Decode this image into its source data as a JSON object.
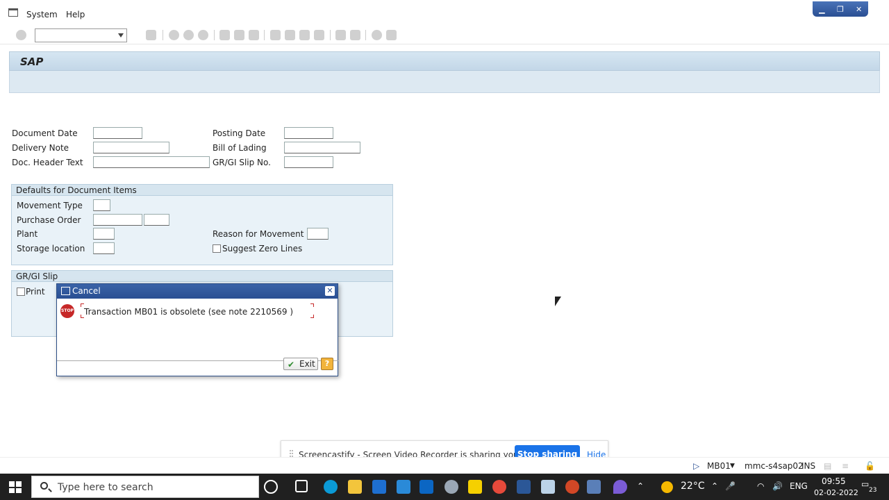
{
  "menu": {
    "items": [
      "System",
      "Help"
    ]
  },
  "screen": {
    "title": "SAP"
  },
  "header_fields": {
    "document_date": {
      "label": "Document Date",
      "value": ""
    },
    "posting_date": {
      "label": "Posting Date",
      "value": ""
    },
    "delivery_note": {
      "label": "Delivery Note",
      "value": ""
    },
    "bill_of_lading": {
      "label": "Bill of Lading",
      "value": ""
    },
    "doc_header_text": {
      "label": "Doc. Header Text",
      "value": ""
    },
    "gr_gi_slip_no": {
      "label": "GR/GI Slip No.",
      "value": ""
    }
  },
  "defaults_group": {
    "title": "Defaults for Document Items",
    "movement_type": "Movement Type",
    "purchase_order": "Purchase Order",
    "plant": "Plant",
    "storage_location": "Storage location",
    "reason_for_movement": "Reason for Movement",
    "suggest_zero_lines": "Suggest Zero Lines"
  },
  "slip_group": {
    "title": "GR/GI Slip",
    "print": "Print"
  },
  "dialog": {
    "title": "Cancel",
    "message": "Transaction MB01 is obsolete (see note 2210569 )",
    "exit_label": "Exit",
    "help_label": "?",
    "stop_icon_text": "STOP"
  },
  "castify": {
    "message": "Screencastify - Screen Video Recorder is sharing your screen.",
    "stop_label": "Stop sharing",
    "hide_label": "Hide"
  },
  "status": {
    "transaction": "MB01",
    "system": "mmc-s4sap02",
    "mode": "INS"
  },
  "taskbar": {
    "search_placeholder": "Type here to search",
    "temperature": "22°C",
    "language": "ENG",
    "time": "09:55",
    "date": "02-02-2022",
    "notifications": "23"
  },
  "colors": {
    "sap_header": "#c3d7e8",
    "dialog_title": "#2a4f93",
    "stop_red": "#c62828",
    "cast_blue": "#1a73e8",
    "taskbar": "#202020"
  }
}
